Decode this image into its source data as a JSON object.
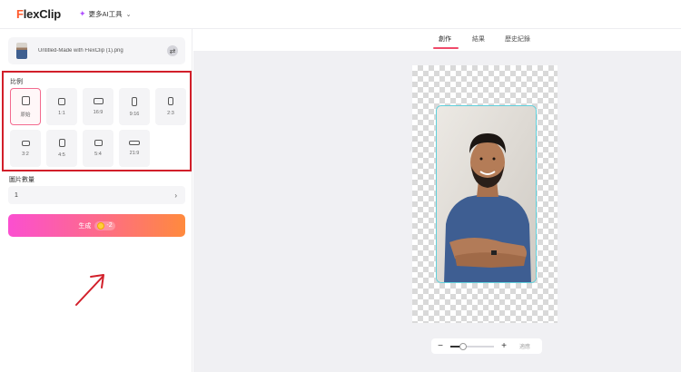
{
  "header": {
    "logo_text": "lexClip",
    "logo_f": "F",
    "ai_tools_label": "更多AI工具"
  },
  "left": {
    "file_name": "Untitled-Made with FlexClip (1).png",
    "ratio_title": "比例",
    "ratios": [
      {
        "label": "原始",
        "selected": true
      },
      {
        "label": "1:1"
      },
      {
        "label": "16:9"
      },
      {
        "label": "9:16"
      },
      {
        "label": "2:3"
      },
      {
        "label": "3:2"
      },
      {
        "label": "4:5"
      },
      {
        "label": "5:4"
      },
      {
        "label": "21:9"
      }
    ],
    "count_label": "圖片數量",
    "count_value": "1",
    "generate_label": "生成",
    "credit_cost": "-2"
  },
  "right": {
    "tabs": [
      {
        "label": "創作",
        "active": true
      },
      {
        "label": "結果"
      },
      {
        "label": "歷史紀錄"
      }
    ],
    "zoom": {
      "minus": "−",
      "plus": "+",
      "fit_label": "適應",
      "level": 0.3
    }
  },
  "colors": {
    "accent": "#f04a6a",
    "highlight_box": "#d21f2a",
    "generate_gradient_start": "#fb4fd0",
    "generate_gradient_end": "#ff8a3d",
    "photo_border": "#5fd0dc"
  }
}
